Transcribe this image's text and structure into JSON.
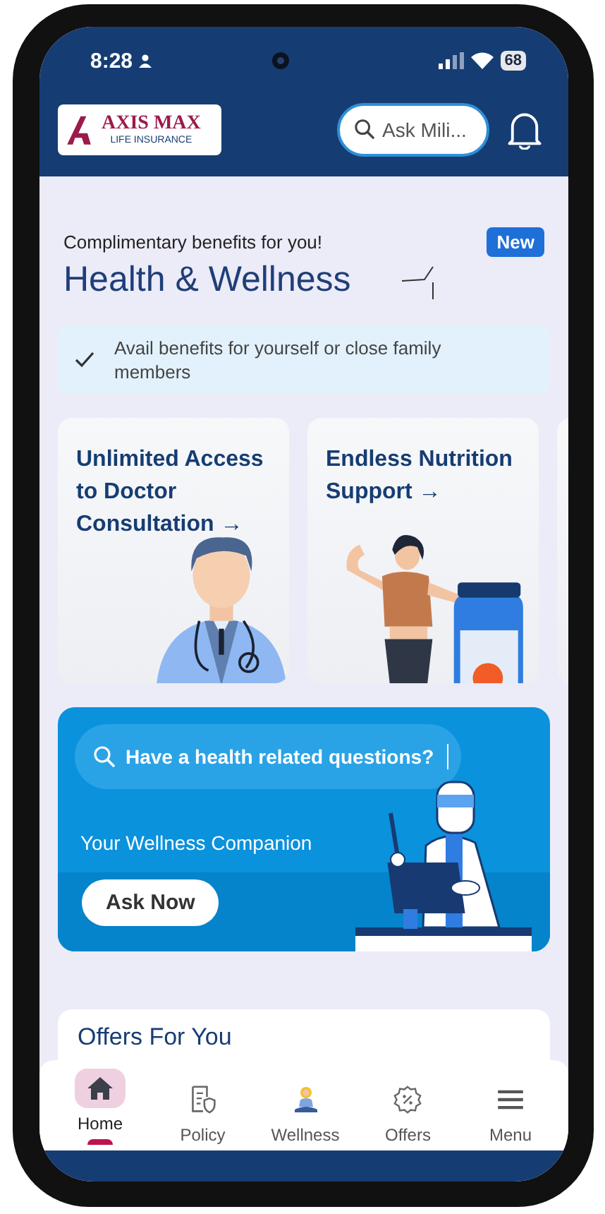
{
  "status_bar": {
    "time": "8:28",
    "battery": "68"
  },
  "header": {
    "logo": {
      "brand": "AXIS MAX",
      "tagline": "LIFE INSURANCE"
    },
    "search": {
      "placeholder": "Ask Mili..."
    }
  },
  "wellness": {
    "eyebrow": "Complimentary benefits for you!",
    "badge": "New",
    "title": "Health & Wellness",
    "note": "Avail benefits for yourself or close family members",
    "cards": [
      {
        "title": "Unlimited Access to Doctor Consultation →",
        "kind": "doctor"
      },
      {
        "title": "Endless Nutrition Support →",
        "kind": "nutrition"
      }
    ]
  },
  "assistant": {
    "placeholder": "Have a health related questions?",
    "subtitle": "Your Wellness Companion",
    "button": "Ask Now"
  },
  "offers": {
    "title": "Offers For You"
  },
  "nav": [
    {
      "label": "Home",
      "kind": "home",
      "selected": true
    },
    {
      "label": "Policy",
      "kind": "policy",
      "selected": false
    },
    {
      "label": "Wellness",
      "kind": "wellness",
      "selected": false
    },
    {
      "label": "Offers",
      "kind": "offers",
      "selected": false
    },
    {
      "label": "Menu",
      "kind": "menu",
      "selected": false
    }
  ]
}
